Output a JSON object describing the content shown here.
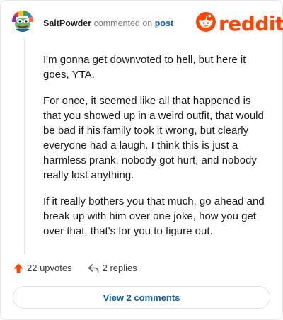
{
  "comment": {
    "username": "SaltPowder",
    "commented_on_text": "commented on",
    "post_link": "post",
    "paragraphs": [
      "I'm gonna get downvoted to hell, but here it goes, YTA.",
      "For once, it seemed like all that happened is that you showed up in a weird outfit, that would be bad if his family took it wrong, but clearly everyone had a laugh. I think this is just a harmless prank, nobody got hurt, and nobody really lost anything.",
      "If it really bothers you that much, go ahead and break up with him over one joke, how you get over that, that's for you to figure out."
    ],
    "upvotes_label": "22 upvotes",
    "replies_label": "2 replies"
  },
  "branding": {
    "wordmark": "reddit",
    "color": "#ff4500"
  },
  "footer": {
    "view_comments_label": "View 2 comments"
  },
  "colors": {
    "upvote": "#ff4500",
    "link": "#0a60b8"
  },
  "icons": {
    "avatar": "avatar-icon",
    "logo": "reddit-logo-icon",
    "upvote": "upvote-arrow-icon",
    "reply": "reply-arrow-icon"
  }
}
